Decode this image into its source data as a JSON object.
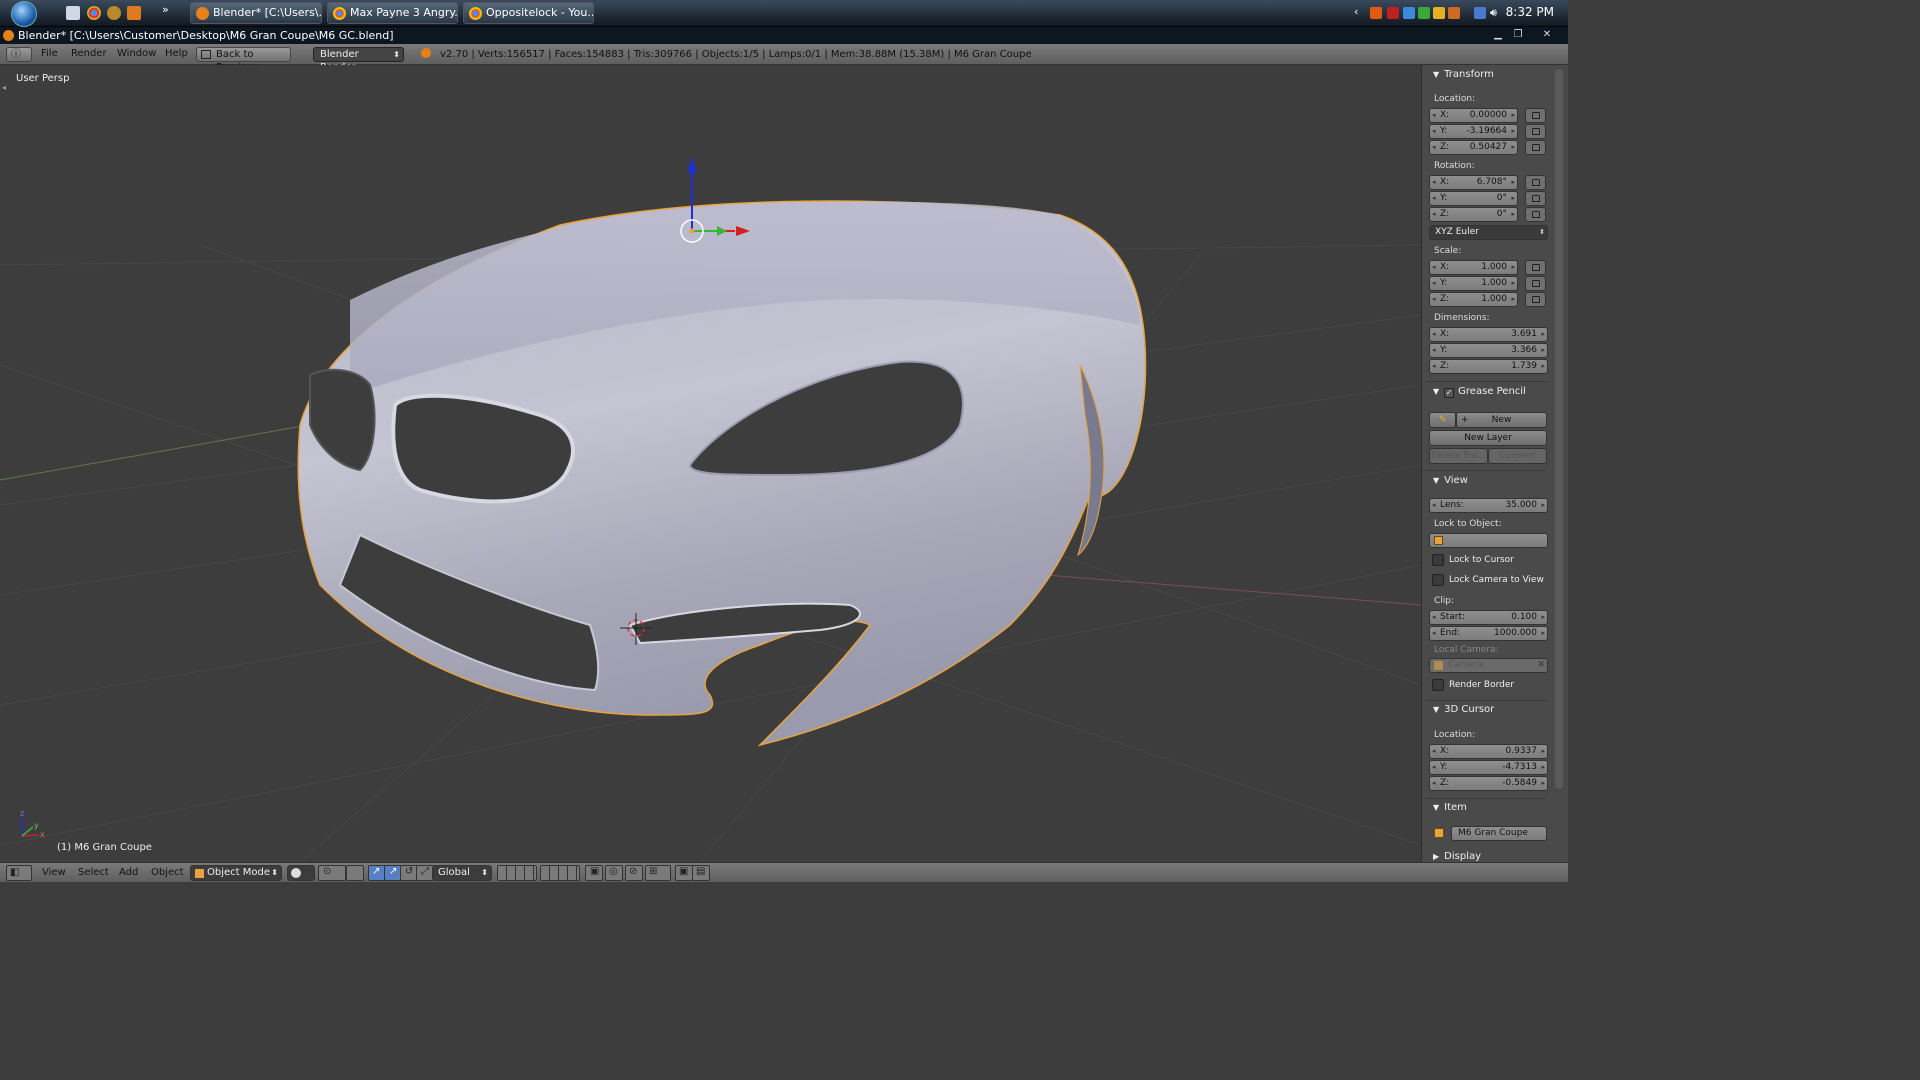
{
  "taskbar": {
    "tasks": [
      {
        "label": "Blender* [C:\\Users\\..."
      },
      {
        "label": "Max Payne 3 Angry..."
      },
      {
        "label": "Oppositelock - You..."
      }
    ],
    "overflow": "»",
    "clock": "8:32 PM"
  },
  "window": {
    "title": "Blender* [C:\\Users\\Customer\\Desktop\\M6 Gran Coupe\\M6 GC.blend]"
  },
  "menubar": {
    "menus": [
      "File",
      "Render",
      "Window",
      "Help"
    ],
    "back_button": "Back to Previous",
    "engine": "Blender Render",
    "stats": "v2.70 | Verts:156517 | Faces:154883 | Tris:309766 | Objects:1/5 | Lamps:0/1 | Mem:38.88M (15.38M) | M6 Gran Coupe"
  },
  "viewport": {
    "view_name": "User Persp",
    "object_label": "(1) M6 Gran Coupe",
    "axis_x": "x",
    "axis_y": "y",
    "axis_z": "z"
  },
  "npanel": {
    "transform": {
      "header": "Transform",
      "location_label": "Location:",
      "location": [
        {
          "k": "X:",
          "v": "0.00000"
        },
        {
          "k": "Y:",
          "v": "-3.19664"
        },
        {
          "k": "Z:",
          "v": "0.50427"
        }
      ],
      "rotation_label": "Rotation:",
      "rotation": [
        {
          "k": "X:",
          "v": "6.708°"
        },
        {
          "k": "Y:",
          "v": "0°"
        },
        {
          "k": "Z:",
          "v": "0°"
        }
      ],
      "rotation_mode": "XYZ Euler",
      "scale_label": "Scale:",
      "scale": [
        {
          "k": "X:",
          "v": "1.000"
        },
        {
          "k": "Y:",
          "v": "1.000"
        },
        {
          "k": "Z:",
          "v": "1.000"
        }
      ],
      "dimensions_label": "Dimensions:",
      "dimensions": [
        {
          "k": "X:",
          "v": "3.691"
        },
        {
          "k": "Y:",
          "v": "3.366"
        },
        {
          "k": "Z:",
          "v": "1.739"
        }
      ]
    },
    "grease_pencil": {
      "header": "Grease Pencil",
      "new": "New",
      "new_layer": "New Layer",
      "delete_frame": "Delete Fra...",
      "convert": "Convert"
    },
    "view": {
      "header": "View",
      "lens_key": "Lens:",
      "lens_val": "35.000",
      "lock_to_object": "Lock to Object:",
      "lock_to_cursor": "Lock to Cursor",
      "lock_camera_to_view": "Lock Camera to View",
      "clip_label": "Clip:",
      "clip_start_key": "Start:",
      "clip_start_val": "0.100",
      "clip_end_key": "End:",
      "clip_end_val": "1000.000",
      "local_camera": "Local Camera:",
      "camera": "Camera",
      "render_border": "Render Border"
    },
    "cursor": {
      "header": "3D Cursor",
      "location_label": "Location:",
      "location": [
        {
          "k": "X:",
          "v": "0.9337"
        },
        {
          "k": "Y:",
          "v": "-4.7313"
        },
        {
          "k": "Z:",
          "v": "-0.5849"
        }
      ]
    },
    "item": {
      "header": "Item",
      "name": "M6 Gran Coupe"
    },
    "display": {
      "header": "Display"
    }
  },
  "bottombar": {
    "menus": [
      "View",
      "Select",
      "Add",
      "Object"
    ],
    "mode": "Object Mode",
    "orientation": "Global"
  },
  "colors": {
    "accent": "#5680c2",
    "selection_outline": "#e8a33c",
    "axis_x": "#d42020",
    "axis_y": "#3cb43c",
    "axis_z": "#2030d0"
  }
}
